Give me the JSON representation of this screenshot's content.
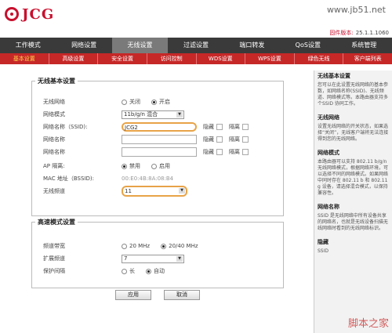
{
  "header": {
    "brand": "JCG",
    "site_url": "www.jb51.net",
    "firmware_label": "固件版本:",
    "firmware_value": "25.1.1.1060"
  },
  "topnav": [
    "工作模式",
    "网络设置",
    "无线设置",
    "过滤设置",
    "端口转发",
    "QoS设置",
    "系统管理"
  ],
  "subnav": [
    "基本设置",
    "高级设置",
    "安全设置",
    "访问控制",
    "WDS设置",
    "WPS设置",
    "绿色无线",
    "客户端列表"
  ],
  "basic": {
    "legend": "无线基本设置",
    "wireless_label": "无线网络",
    "off_label": "关闭",
    "on_label": "开启",
    "mode_label": "网络模式",
    "mode_value": "11b/g/n 混合",
    "ssid_label": "网络名称（SSID):",
    "ssid_value": "JCG2",
    "hide_label": "隐藏",
    "isolate_label": "隔离",
    "ssid2_label": "网络名称",
    "ssid3_label": "网络名称",
    "ap_iso_label": "AP 隔离:",
    "disable_label": "禁用",
    "enable_label": "启用",
    "mac_label": "MAC 地址（BSSID):",
    "mac_value": "00:E0:4B:8A:08:B4",
    "channel_label": "无线频道",
    "channel_value": "11"
  },
  "advanced": {
    "legend": "高速模式设置",
    "bandwidth_label": "频道带宽",
    "bw_20": "20 MHz",
    "bw_2040": "20/40 MHz",
    "ext_label": "扩展频道",
    "ext_value": "7",
    "guard_label": "保护间隔",
    "long_label": "长",
    "auto_label": "自动"
  },
  "buttons": {
    "apply": "应用",
    "cancel": "取消"
  },
  "help": [
    {
      "title": "无线基本设置",
      "text": "您可以在此设置无线网络的基本参数，如网络名称(SSID)、无线频道、网络模式等。本路由器支持多个SSID 协同工作。"
    },
    {
      "title": "无线网络",
      "text": "设置无线网络的开关状态，如果选择“关闭”，无线客户端将无法连接得到您的无线网络。"
    },
    {
      "title": "网络模式",
      "text": "本路由器可以支持 802.11 b/g/n 无线网络模式，根据网络环境，可以选择不同的网络模式。如果网络中同时存在 802.11 b 和 802.11 g 设备，请选择混合模式，以保持兼容性。"
    },
    {
      "title": "网络名称",
      "text": "SSID 是无线网络中所有设备共享的网络名，也就是无线设备扫描无线网络时看到的无线网络标识。"
    },
    {
      "title": "隐藏",
      "text": "SSID"
    }
  ],
  "watermark": "脚本之家"
}
